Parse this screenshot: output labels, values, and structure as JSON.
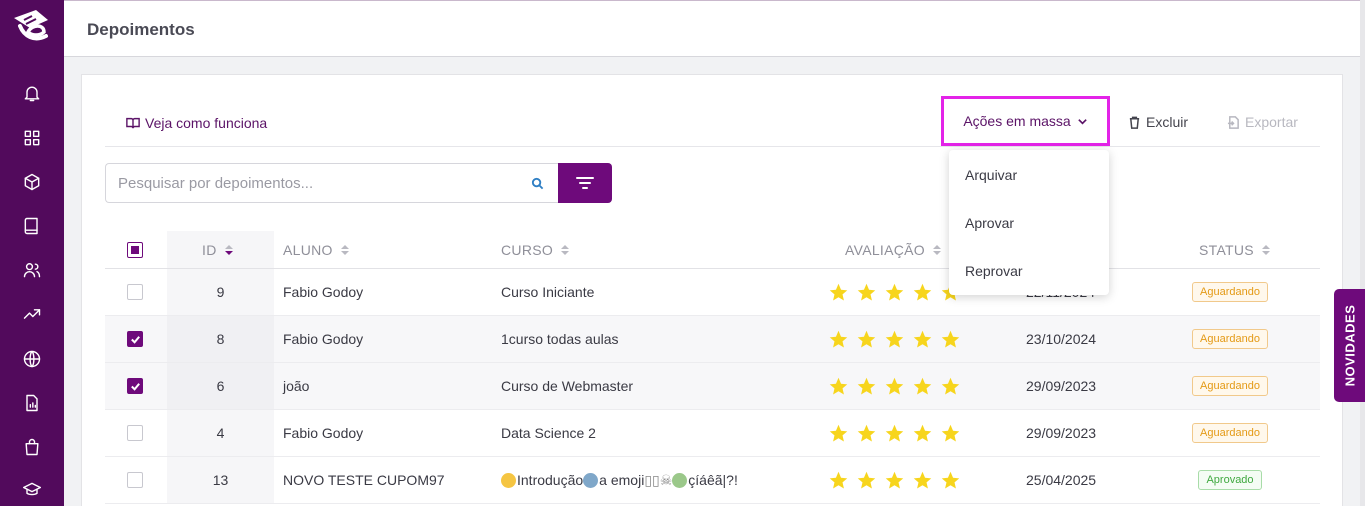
{
  "header": {
    "title": "Depoimentos"
  },
  "toolbar": {
    "how_it_works": "Veja como funciona",
    "bulk_actions": "Ações em massa",
    "delete": "Excluir",
    "export": "Exportar"
  },
  "search": {
    "placeholder": "Pesquisar por depoimentos..."
  },
  "bulk_menu": {
    "items": [
      "Arquivar",
      "Aprovar",
      "Reprovar"
    ]
  },
  "table": {
    "columns": {
      "id": "ID",
      "student": "ALUNO",
      "course": "CURSO",
      "rating": "AVALIAÇÃO",
      "status": "STATUS"
    },
    "rows": [
      {
        "id": "9",
        "student": "Fabio Godoy",
        "course": "Curso Iniciante",
        "rating": 5,
        "date": "22/11/2024",
        "status": "Aguardando",
        "checked": false
      },
      {
        "id": "8",
        "student": "Fabio Godoy",
        "course": "1curso todas aulas",
        "rating": 5,
        "date": "23/10/2024",
        "status": "Aguardando",
        "checked": true
      },
      {
        "id": "6",
        "student": "joão",
        "course": "Curso de Webmaster",
        "rating": 5,
        "date": "29/09/2023",
        "status": "Aguardando",
        "checked": true
      },
      {
        "id": "4",
        "student": "Fabio Godoy",
        "course": "Data Science 2",
        "rating": 5,
        "date": "29/09/2023",
        "status": "Aguardando",
        "checked": false
      },
      {
        "id": "13",
        "student": "NOVO TESTE CUPOM97",
        "course_parts": [
          "Introdução",
          " a emoji ",
          "çíáêã|?!"
        ],
        "rating": 5,
        "date": "25/04/2025",
        "status": "Aprovado",
        "checked": false
      }
    ]
  },
  "side_tab": {
    "label": "NOVIDADES"
  },
  "colors": {
    "primary": "#6e0a7b",
    "sidebar": "#520a5c",
    "highlight": "#e323e8",
    "star": "#f7d51d",
    "waiting": "#e49a16",
    "approved": "#3fa83f"
  },
  "sidebar_icons": [
    "bell-icon",
    "grid-icon",
    "box-icon",
    "book-icon",
    "users-icon",
    "trending-icon",
    "globe-icon",
    "report-icon",
    "bag-icon",
    "graduation-cap-icon"
  ]
}
